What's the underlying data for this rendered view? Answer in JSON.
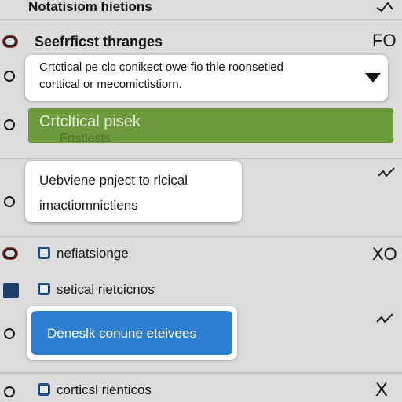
{
  "header": {
    "title": "Notatisiom hietions"
  },
  "section": {
    "title": "Seefrficst thranges",
    "glyph": "FO"
  },
  "dropdown": {
    "line1": "Crtctical pe clc conikect owe fio thie roonsetied",
    "line2": "corttical or mecomictistiorn."
  },
  "banner": {
    "line1": "Crtcltical pisek",
    "line2": "Frtstlests"
  },
  "card": {
    "line1": "Uebviene pnject to rlcical",
    "line2": "imactiomnictiens"
  },
  "rows": [
    {
      "label": "nefiatsionge",
      "glyph": "XO"
    },
    {
      "label": "setical rietcicnos",
      "glyph": ""
    },
    {
      "label": "corticsl rienticos",
      "glyph": "X"
    }
  ],
  "primary_button": {
    "label": "Deneslk conune eteivees"
  },
  "colors": {
    "background": "#dcdcdc",
    "banner_green": "#6e9a3e",
    "button_blue": "#2d7fd3",
    "icon_blue": "#1f4f8a",
    "icon_dark_blue": "#1d3f6b"
  },
  "icons": {
    "header_right": "checkmark-tilde-icon",
    "row_right": "check-icon"
  }
}
